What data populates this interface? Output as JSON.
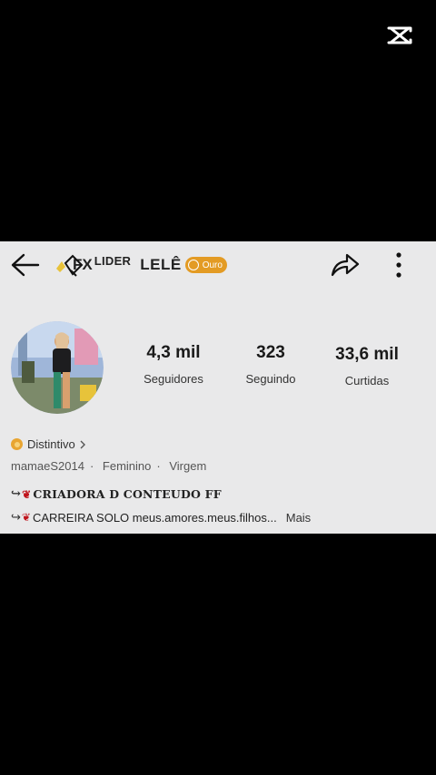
{
  "profile": {
    "title_prefix": "FX",
    "title_tag": "LIDER",
    "name": "LELÊ",
    "level_badge": "Ouro",
    "stats": [
      {
        "value": "4,3 mil",
        "label": "Seguidores"
      },
      {
        "value": "323",
        "label": "Seguindo"
      },
      {
        "value": "33,6 mil",
        "label": "Curtidas"
      }
    ],
    "distintivo": "Distintivo",
    "meta": {
      "username": "mamaeS2014",
      "gender": "Feminino",
      "sign": "Virgem"
    },
    "bio_line1": "CRIADORA D CONTEUDO FF",
    "bio_line2": "CARREIRA SOLO meus.amores.meus.filhos...",
    "bio_more": "Mais"
  },
  "colors": {
    "background": "#000000",
    "panel": "#e9e9ea",
    "badge": "#e39b24",
    "accent_rose": "#c0141c"
  },
  "icons": [
    "capcut-logo",
    "back-arrow-icon",
    "share-icon",
    "more-vertical-icon",
    "gold-coin-icon",
    "distintivo-icon",
    "rose-icon"
  ]
}
